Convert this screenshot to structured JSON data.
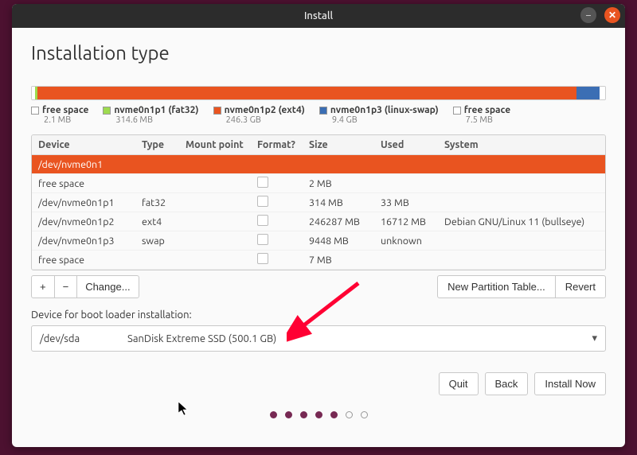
{
  "window": {
    "title": "Install"
  },
  "heading": "Installation type",
  "segments": [
    {
      "color": "#ffffff",
      "width": "0.5%"
    },
    {
      "color": "#9edb4f",
      "width": "0.5%"
    },
    {
      "color": "#e95420",
      "width": "94%"
    },
    {
      "color": "#3b6eb4",
      "width": "4%"
    },
    {
      "color": "#ffffff",
      "width": "1%"
    }
  ],
  "legend": [
    {
      "color": "#ffffff",
      "label": "free space",
      "sub": "2.1 MB"
    },
    {
      "color": "#9edb4f",
      "label": "nvme0n1p1 (fat32)",
      "sub": "314.6 MB"
    },
    {
      "color": "#e95420",
      "label": "nvme0n1p2 (ext4)",
      "sub": "246.3 GB"
    },
    {
      "color": "#3b6eb4",
      "label": "nvme0n1p3 (linux-swap)",
      "sub": "9.4 GB"
    },
    {
      "color": "#ffffff",
      "label": "free space",
      "sub": "7.5 MB"
    }
  ],
  "columns": {
    "c0": "Device",
    "c1": "Type",
    "c2": "Mount point",
    "c3": "Format?",
    "c4": "Size",
    "c5": "Used",
    "c6": "System"
  },
  "rows": [
    {
      "device": "/dev/nvme0n1",
      "type": "",
      "mount": "",
      "format": false,
      "size": "",
      "used": "",
      "system": "",
      "selected": true,
      "header": true
    },
    {
      "device": " free space",
      "type": "",
      "mount": "",
      "format": true,
      "size": "2 MB",
      "used": "",
      "system": ""
    },
    {
      "device": " /dev/nvme0n1p1",
      "type": "fat32",
      "mount": "",
      "format": true,
      "size": "314 MB",
      "used": "33 MB",
      "system": ""
    },
    {
      "device": " /dev/nvme0n1p2",
      "type": "ext4",
      "mount": "",
      "format": true,
      "size": "246287 MB",
      "used": "16712 MB",
      "system": "Debian GNU/Linux 11 (bullseye)"
    },
    {
      "device": " /dev/nvme0n1p3",
      "type": "swap",
      "mount": "",
      "format": true,
      "size": "9448 MB",
      "used": "unknown",
      "system": ""
    },
    {
      "device": " free space",
      "type": "",
      "mount": "",
      "format": true,
      "size": "7 MB",
      "used": "",
      "system": ""
    }
  ],
  "toolbar": {
    "add": "+",
    "remove": "−",
    "change": "Change...",
    "newtable": "New Partition Table...",
    "revert": "Revert"
  },
  "bootloader": {
    "label": "Device for boot loader installation:",
    "device": "/dev/sda",
    "desc": "SanDisk Extreme SSD (500.1 GB)"
  },
  "footer": {
    "quit": "Quit",
    "back": "Back",
    "install": "Install Now"
  },
  "pager_total": 7,
  "pager_active": 5
}
